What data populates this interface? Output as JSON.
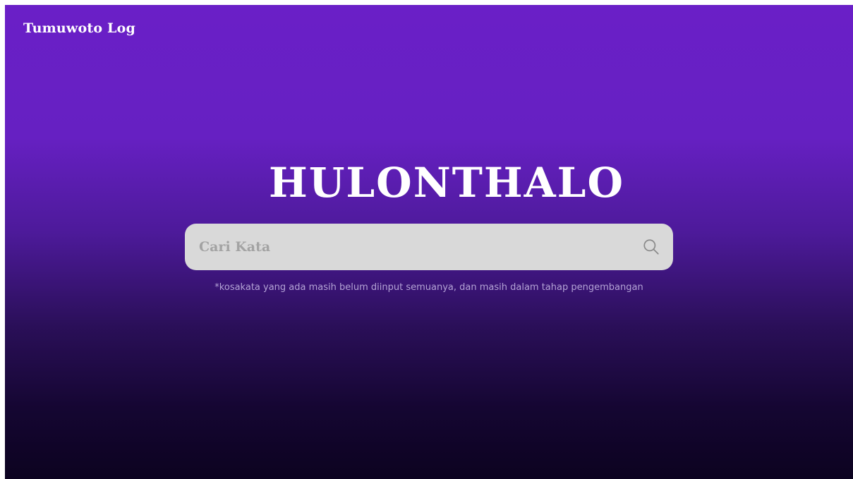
{
  "header": {
    "brand": "Tumuwoto Log"
  },
  "hero": {
    "title": "HULONTHALO"
  },
  "search": {
    "placeholder": "Cari Kata",
    "value": "",
    "icon": "search-icon"
  },
  "note": {
    "text": "*kosakata yang ada masih belum diinput semuanya, dan masih dalam tahap pengembangan"
  },
  "colors": {
    "gradient_top": "#6a1fc7",
    "gradient_bottom": "#0c0320",
    "search_bg": "#d9d9d9",
    "note_text": "#b4a3d6"
  }
}
